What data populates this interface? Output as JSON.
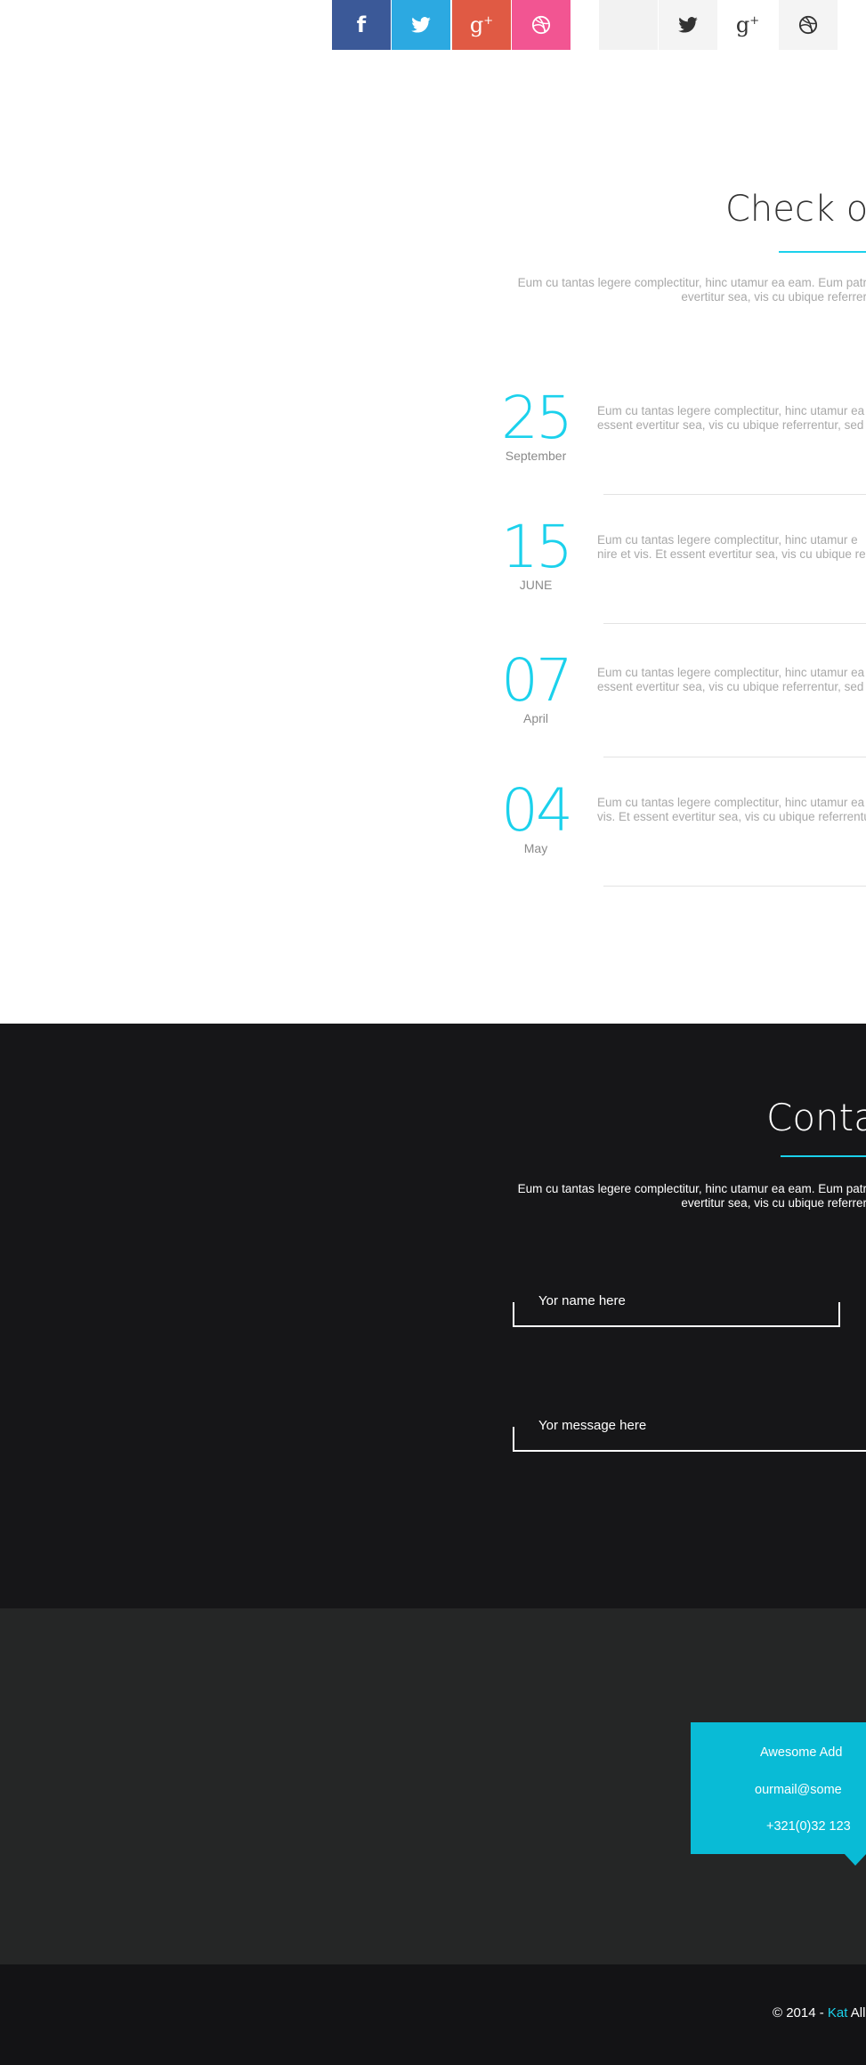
{
  "colors": {
    "accent": "#1bd1ec",
    "facebook": "#3b5998",
    "twitter": "#2ca9e1",
    "google_plus": "#e05a44",
    "dribbble": "#f25592",
    "contact_bg": "#161618",
    "address_bg": "#252626",
    "address_box": "#09bbd6",
    "footer_bg": "#131315"
  },
  "social": {
    "colored": [
      "facebook-icon",
      "twitter-icon",
      "google-plus-icon",
      "dribbble-icon"
    ],
    "grey": [
      "blank",
      "twitter-icon",
      "google-plus-icon",
      "dribbble-icon"
    ],
    "facebook_glyph": "f",
    "google_plus_glyph": "g",
    "google_plus_sup": "+"
  },
  "blog": {
    "title": "Check ou",
    "intro_line1": "Eum cu tantas legere complectitur, hinc utamur ea eam. Eum patr",
    "intro_line2": "evertitur sea, vis cu ubique referrer",
    "posts": [
      {
        "day": "25",
        "month": "September",
        "line1": "Eum cu tantas legere complectitur, hinc utamur ea ea",
        "line2": "essent evertitur sea, vis cu ubique referrentur, sed eu"
      },
      {
        "day": "15",
        "month": "JUNE",
        "line1": "Eum cu tantas legere complectitur, hinc utamur e",
        "line2": "nire et vis. Et essent evertitur sea, vis cu ubique re"
      },
      {
        "day": "07",
        "month": "April",
        "line1": "Eum cu tantas legere complectitur, hinc utamur ea ea",
        "line2": "essent evertitur sea, vis cu ubique referrentur, sed eu"
      },
      {
        "day": "04",
        "month": "May",
        "line1": "Eum cu tantas legere complectitur, hinc utamur ea",
        "line2": "vis. Et essent evertitur sea, vis cu ubique referrentur"
      }
    ]
  },
  "contact": {
    "title": "Contac",
    "intro_line1": "Eum cu tantas legere complectitur, hinc utamur ea eam. Eum patr",
    "intro_line2": "evertitur sea, vis cu ubique referrer",
    "name_placeholder": "Yor name here",
    "message_placeholder": "Yor message here"
  },
  "address": {
    "line1": "Awesome Add",
    "line2": "ourmail@some",
    "line3": "+321(0)32 123"
  },
  "footer": {
    "copyright_prefix": "© 2014 - ",
    "brand": "Kat",
    "copyright_suffix": " All"
  }
}
